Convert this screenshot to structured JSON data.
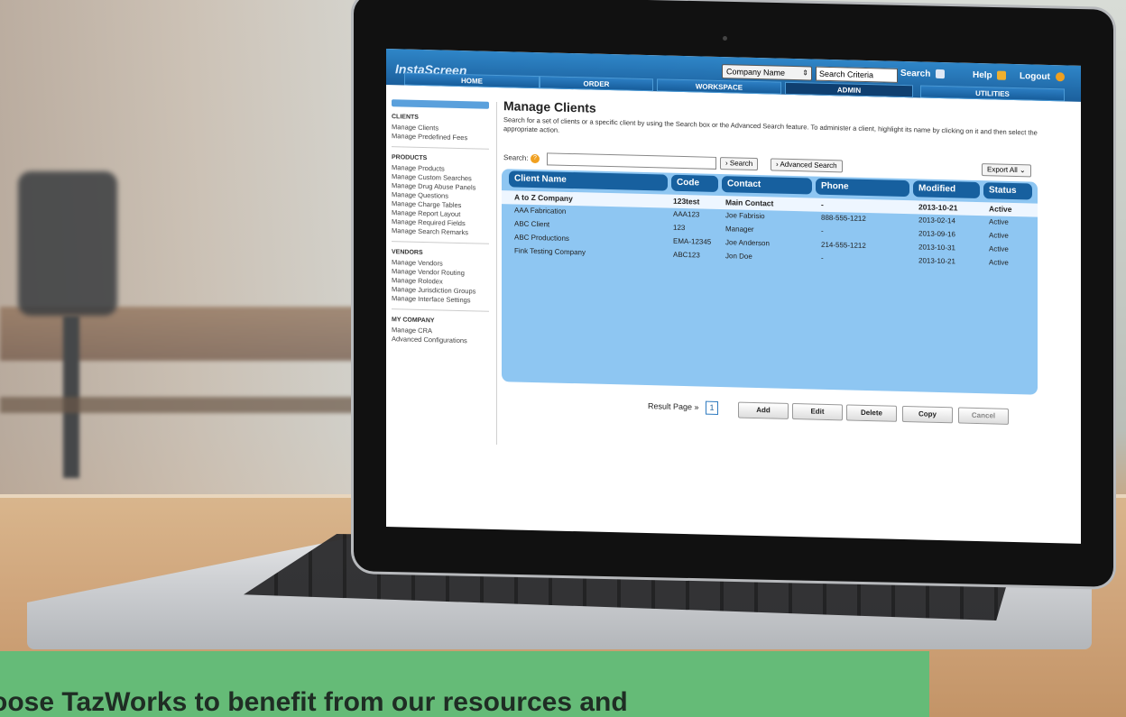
{
  "app": {
    "logo": "InstaScreen",
    "header": {
      "company_select": "Company Name",
      "search_criteria_value": "Search Criteria",
      "search_link": "Search",
      "help_link": "Help",
      "logout_link": "Logout"
    },
    "nav_tabs": [
      {
        "label": "HOME",
        "active": false
      },
      {
        "label": "ORDER",
        "active": false
      },
      {
        "label": "WORKSPACE",
        "active": false
      },
      {
        "label": "ADMIN",
        "active": true
      },
      {
        "label": "UTILITIES",
        "active": false
      }
    ]
  },
  "sidebar": {
    "clients": {
      "heading": "CLIENTS",
      "items": [
        "Manage Clients",
        "Manage Predefined Fees"
      ]
    },
    "products": {
      "heading": "PRODUCTS",
      "items": [
        "Manage Products",
        "Manage Custom Searches",
        "Manage Drug Abuse Panels",
        "Manage Questions",
        "Manage Charge Tables",
        "Manage Report Layout",
        "Manage Required Fields",
        "Manage Search Remarks"
      ]
    },
    "vendors": {
      "heading": "VENDORS",
      "items": [
        "Manage Vendors",
        "Manage Vendor Routing",
        "Manage Rolodex",
        "Manage Jurisdiction Groups",
        "Manage Interface Settings"
      ]
    },
    "my_company": {
      "heading": "MY COMPANY",
      "items": [
        "Manage CRA",
        "Advanced Configurations"
      ]
    }
  },
  "main": {
    "title": "Manage Clients",
    "description": "Search for a set of clients or a specific client by using the Search box or the Advanced Search feature. To administer a client, highlight its name by clicking on it and then select the appropriate action.",
    "search_label": "Search:",
    "search_button": "› Search",
    "advanced_search_button": "› Advanced Search",
    "export_button": "Export All ⌄",
    "columns": [
      "Client Name",
      "Code",
      "Contact",
      "Phone",
      "Modified",
      "Status"
    ],
    "rows": [
      {
        "name": "A to Z Company",
        "code": "123test",
        "contact": "Main Contact",
        "phone": "-",
        "modified": "2013-10-21",
        "status": "Active",
        "selected": true
      },
      {
        "name": "AAA Fabrication",
        "code": "AAA123",
        "contact": "Joe Fabrisio",
        "phone": "888-555-1212",
        "modified": "2013-02-14",
        "status": "Active",
        "selected": false
      },
      {
        "name": "ABC Client",
        "code": "123",
        "contact": "Manager",
        "phone": "-",
        "modified": "2013-09-16",
        "status": "Active",
        "selected": false
      },
      {
        "name": "ABC Productions",
        "code": "EMA-12345",
        "contact": "Joe Anderson",
        "phone": "214-555-1212",
        "modified": "2013-10-31",
        "status": "Active",
        "selected": false
      },
      {
        "name": "Fink Testing Company",
        "code": "ABC123",
        "contact": "Jon Doe",
        "phone": "-",
        "modified": "2013-10-21",
        "status": "Active",
        "selected": false
      }
    ],
    "result_page_label": "Result Page »",
    "result_page_number": "1",
    "actions": [
      "Add",
      "Edit",
      "Delete",
      "Copy",
      "Cancel"
    ]
  },
  "banner": {
    "text": "oose TazWorks to benefit from our resources and"
  }
}
